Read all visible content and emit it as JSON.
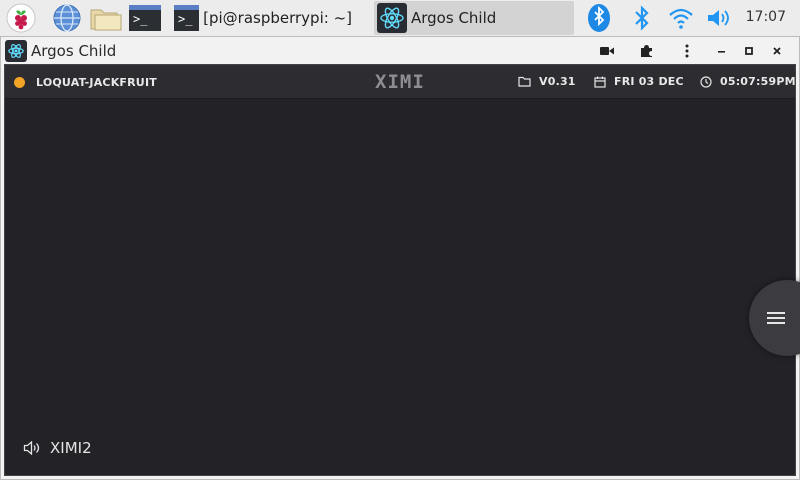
{
  "taskbar": {
    "tasks": [
      {
        "label": "[pi@raspberrypi: ~]"
      },
      {
        "label": "Argos Child"
      }
    ],
    "clock": "17:07",
    "colors": {
      "bluetooth": "#1e88e5",
      "accent": "#2196f3"
    }
  },
  "window": {
    "title": "Argos Child"
  },
  "app": {
    "device_name": "LOQUAT-JACKFRUIT",
    "logo": "XIMI",
    "version": "V0.31",
    "date": "FRI 03 DEC",
    "time": "05:07:59PM",
    "status_color": "#f3a325",
    "footer_label": "XIMI2"
  }
}
